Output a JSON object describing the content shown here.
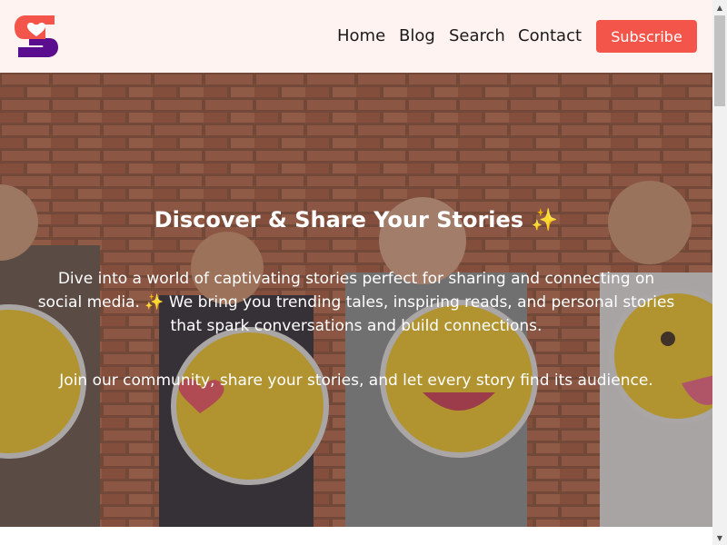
{
  "header": {
    "logo_icon": "heart-s-logo-icon",
    "nav": {
      "home_label": "Home",
      "blog_label": "Blog",
      "search_label": "Search",
      "contact_label": "Contact"
    },
    "subscribe_label": "Subscribe"
  },
  "hero": {
    "background_icon": "people-holding-emoji-faces-photo",
    "title": "Discover & Share Your Stories ✨",
    "paragraph_lines": [
      "Dive into a world of captivating stories perfect for sharing and connecting on",
      "social media. ✨ We bring you trending tales, inspiring reads, and personal stories",
      "that spark conversations and build connections."
    ],
    "join_text": "Join our community, share your stories, and let every story find its audience."
  },
  "colors": {
    "header_bg": "#fff3f1",
    "accent": "#f4554a",
    "logo_purple": "#5b0d8f",
    "text_dark": "#1a1a1a"
  }
}
